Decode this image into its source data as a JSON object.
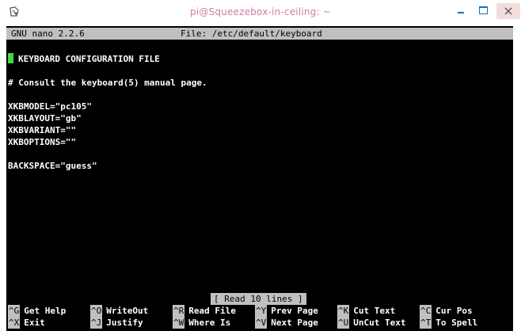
{
  "window": {
    "title": "pi@Squeezebox-in-ceiling: ~",
    "accent_color": "#d07aa6",
    "icons": [
      "terminal-icon",
      "minimize-icon",
      "maximize-icon",
      "close-icon"
    ]
  },
  "nano": {
    "version_label": "GNU nano 2.2.6",
    "file_label": "File: /etc/default/keyboard",
    "lines": [
      "KEYBOARD CONFIGURATION FILE",
      "",
      "# Consult the keyboard(5) manual page.",
      "",
      "XKBMODEL=\"pc105\"",
      "XKBLAYOUT=\"gb\"",
      "XKBVARIANT=\"\"",
      "XKBOPTIONS=\"\"",
      "",
      "BACKSPACE=\"guess\""
    ],
    "status_message": "[ Read 10 lines ]",
    "shortcuts_row1": [
      {
        "key": "^G",
        "label": "Get Help"
      },
      {
        "key": "^O",
        "label": "WriteOut"
      },
      {
        "key": "^R",
        "label": "Read File"
      },
      {
        "key": "^Y",
        "label": "Prev Page"
      },
      {
        "key": "^K",
        "label": "Cut Text"
      },
      {
        "key": "^C",
        "label": "Cur Pos"
      }
    ],
    "shortcuts_row2": [
      {
        "key": "^X",
        "label": "Exit"
      },
      {
        "key": "^J",
        "label": "Justify"
      },
      {
        "key": "^W",
        "label": "Where Is"
      },
      {
        "key": "^V",
        "label": "Next Page"
      },
      {
        "key": "^U",
        "label": "UnCut Text"
      },
      {
        "key": "^T",
        "label": "To Spell"
      }
    ]
  }
}
